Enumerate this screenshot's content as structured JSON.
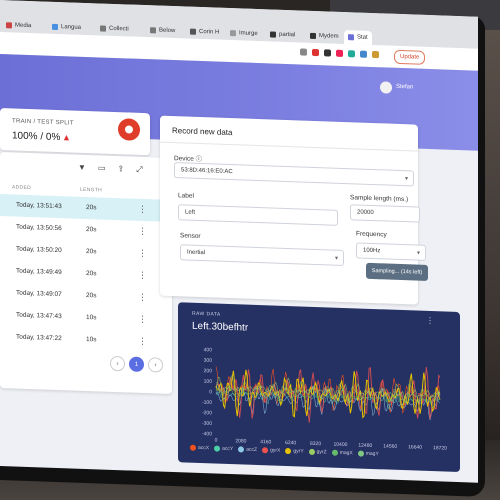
{
  "browser": {
    "tabs": [
      "Media",
      "Langua",
      "Collecti",
      "Below",
      "Corin H",
      "Imurge",
      "partial",
      "Mydem",
      "Stat"
    ],
    "update_label": "Update"
  },
  "user": {
    "name": "Stefan"
  },
  "split": {
    "label": "TRAIN / TEST SPLIT",
    "value": "100% / 0%"
  },
  "table": {
    "headers": [
      "ADDED",
      "LENGTH"
    ],
    "rows": [
      {
        "added": "Today, 13:51:43",
        "length": "20s"
      },
      {
        "added": "Today, 13:50:56",
        "length": "20s"
      },
      {
        "added": "Today, 13:50:20",
        "length": "20s"
      },
      {
        "added": "Today, 13:49:49",
        "length": "20s"
      },
      {
        "added": "Today, 13:49:07",
        "length": "20s"
      },
      {
        "added": "Today, 13:47:43",
        "length": "10s"
      },
      {
        "added": "Today, 13:47:22",
        "length": "10s"
      }
    ],
    "page": "1",
    "prev": "‹",
    "next": "›",
    "menu_glyph": "⋮"
  },
  "record": {
    "title": "Record new data",
    "device_label": "Device ⓘ",
    "device_value": "53:8D:46:16:E0:AC",
    "label_label": "Label",
    "label_value": "Left",
    "length_label": "Sample length (ms.)",
    "length_value": "20000",
    "sensor_label": "Sensor",
    "sensor_value": "Inertial",
    "freq_label": "Frequency",
    "freq_value": "100Hz",
    "button_label": "Sampling... (14s left)"
  },
  "raw": {
    "label": "RAW DATA",
    "title": "Left.30befhtr",
    "menu_glyph": "⋮"
  },
  "chart_data": {
    "type": "line",
    "yticks": [
      400,
      300,
      200,
      100,
      0,
      -100,
      -200,
      -300,
      -400
    ],
    "xticks": [
      0,
      2080,
      4160,
      6240,
      8320,
      10400,
      12480,
      14560,
      16640,
      18720
    ],
    "ylim": [
      -400,
      400
    ],
    "series": [
      {
        "name": "accX",
        "color": "#f4511e"
      },
      {
        "name": "accY",
        "color": "#4dd0a8"
      },
      {
        "name": "accZ",
        "color": "#8ecae6"
      },
      {
        "name": "gyrX",
        "color": "#ef5350"
      },
      {
        "name": "gyrY",
        "color": "#e6c200"
      },
      {
        "name": "gyrZ",
        "color": "#9ccc65"
      },
      {
        "name": "magX",
        "color": "#66bb6a"
      },
      {
        "name": "magY",
        "color": "#81c784"
      }
    ]
  },
  "colors": {
    "accent": "#6c6fd6",
    "raw_bg": "#253063",
    "selected_row": "#d7f1f7"
  }
}
